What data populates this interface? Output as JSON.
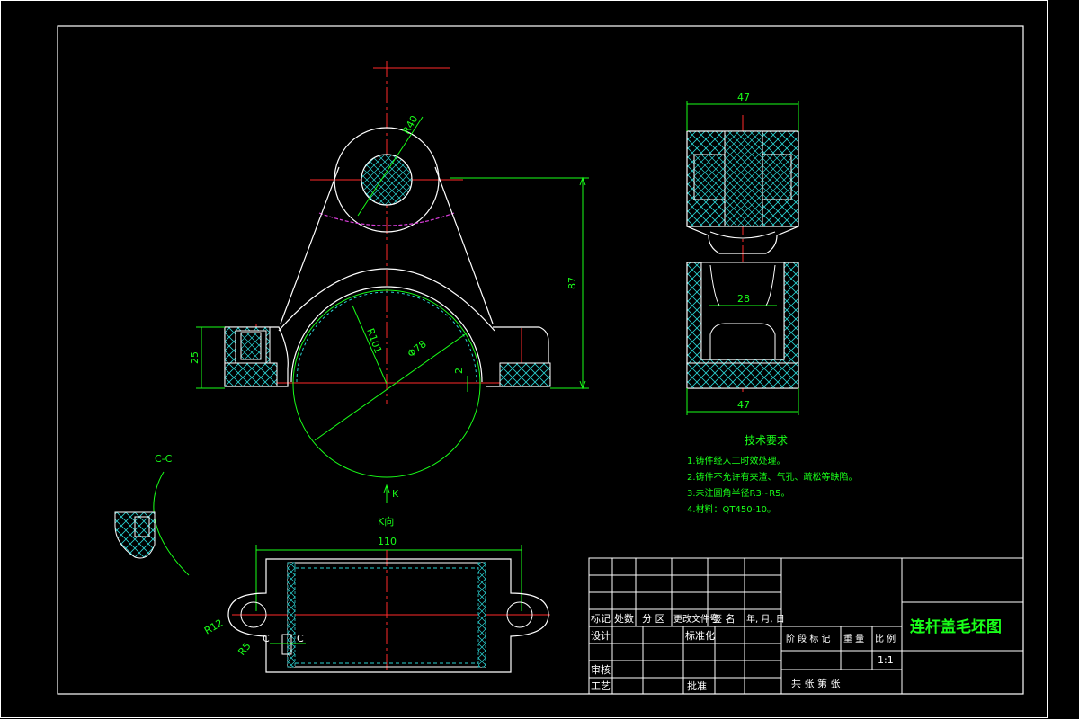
{
  "drawing": {
    "title": "连杆盖毛坯图",
    "scale": "1:1",
    "views": {
      "section_label": "C-C",
      "view_arrow_label": "K",
      "view_k_label": "K向"
    },
    "dimensions": {
      "d40": "R40",
      "r101": "R101",
      "d78": "Φ78",
      "h87": "87",
      "h25": "25",
      "gap2": "2",
      "w47_top": "47",
      "w28": "28",
      "w47_bottom": "47",
      "l110": "110",
      "r12": "R12",
      "r_small": "R5",
      "c_left": "C",
      "c_right": "C"
    },
    "tech_requirements": {
      "heading": "技术要求",
      "items": [
        "1.铸件经人工时效处理。",
        "2.铸件不允许有夹渣、气孔、疏松等缺陷。",
        "3.未注圆角半径R3~R5。",
        "4.材料：QT450-10。"
      ]
    },
    "title_block": {
      "row_headers": [
        "标记",
        "处数",
        "分 区",
        "更改文件号",
        "签 名",
        "年, 月, 日"
      ],
      "design": "设计",
      "standardization": "标准化",
      "review": "审核",
      "process": "工艺",
      "approve": "批准",
      "stage_mark": "阶 段 标 记",
      "weight": "重 量",
      "ratio": "比 例",
      "sheets": "共   张   第   张"
    }
  }
}
